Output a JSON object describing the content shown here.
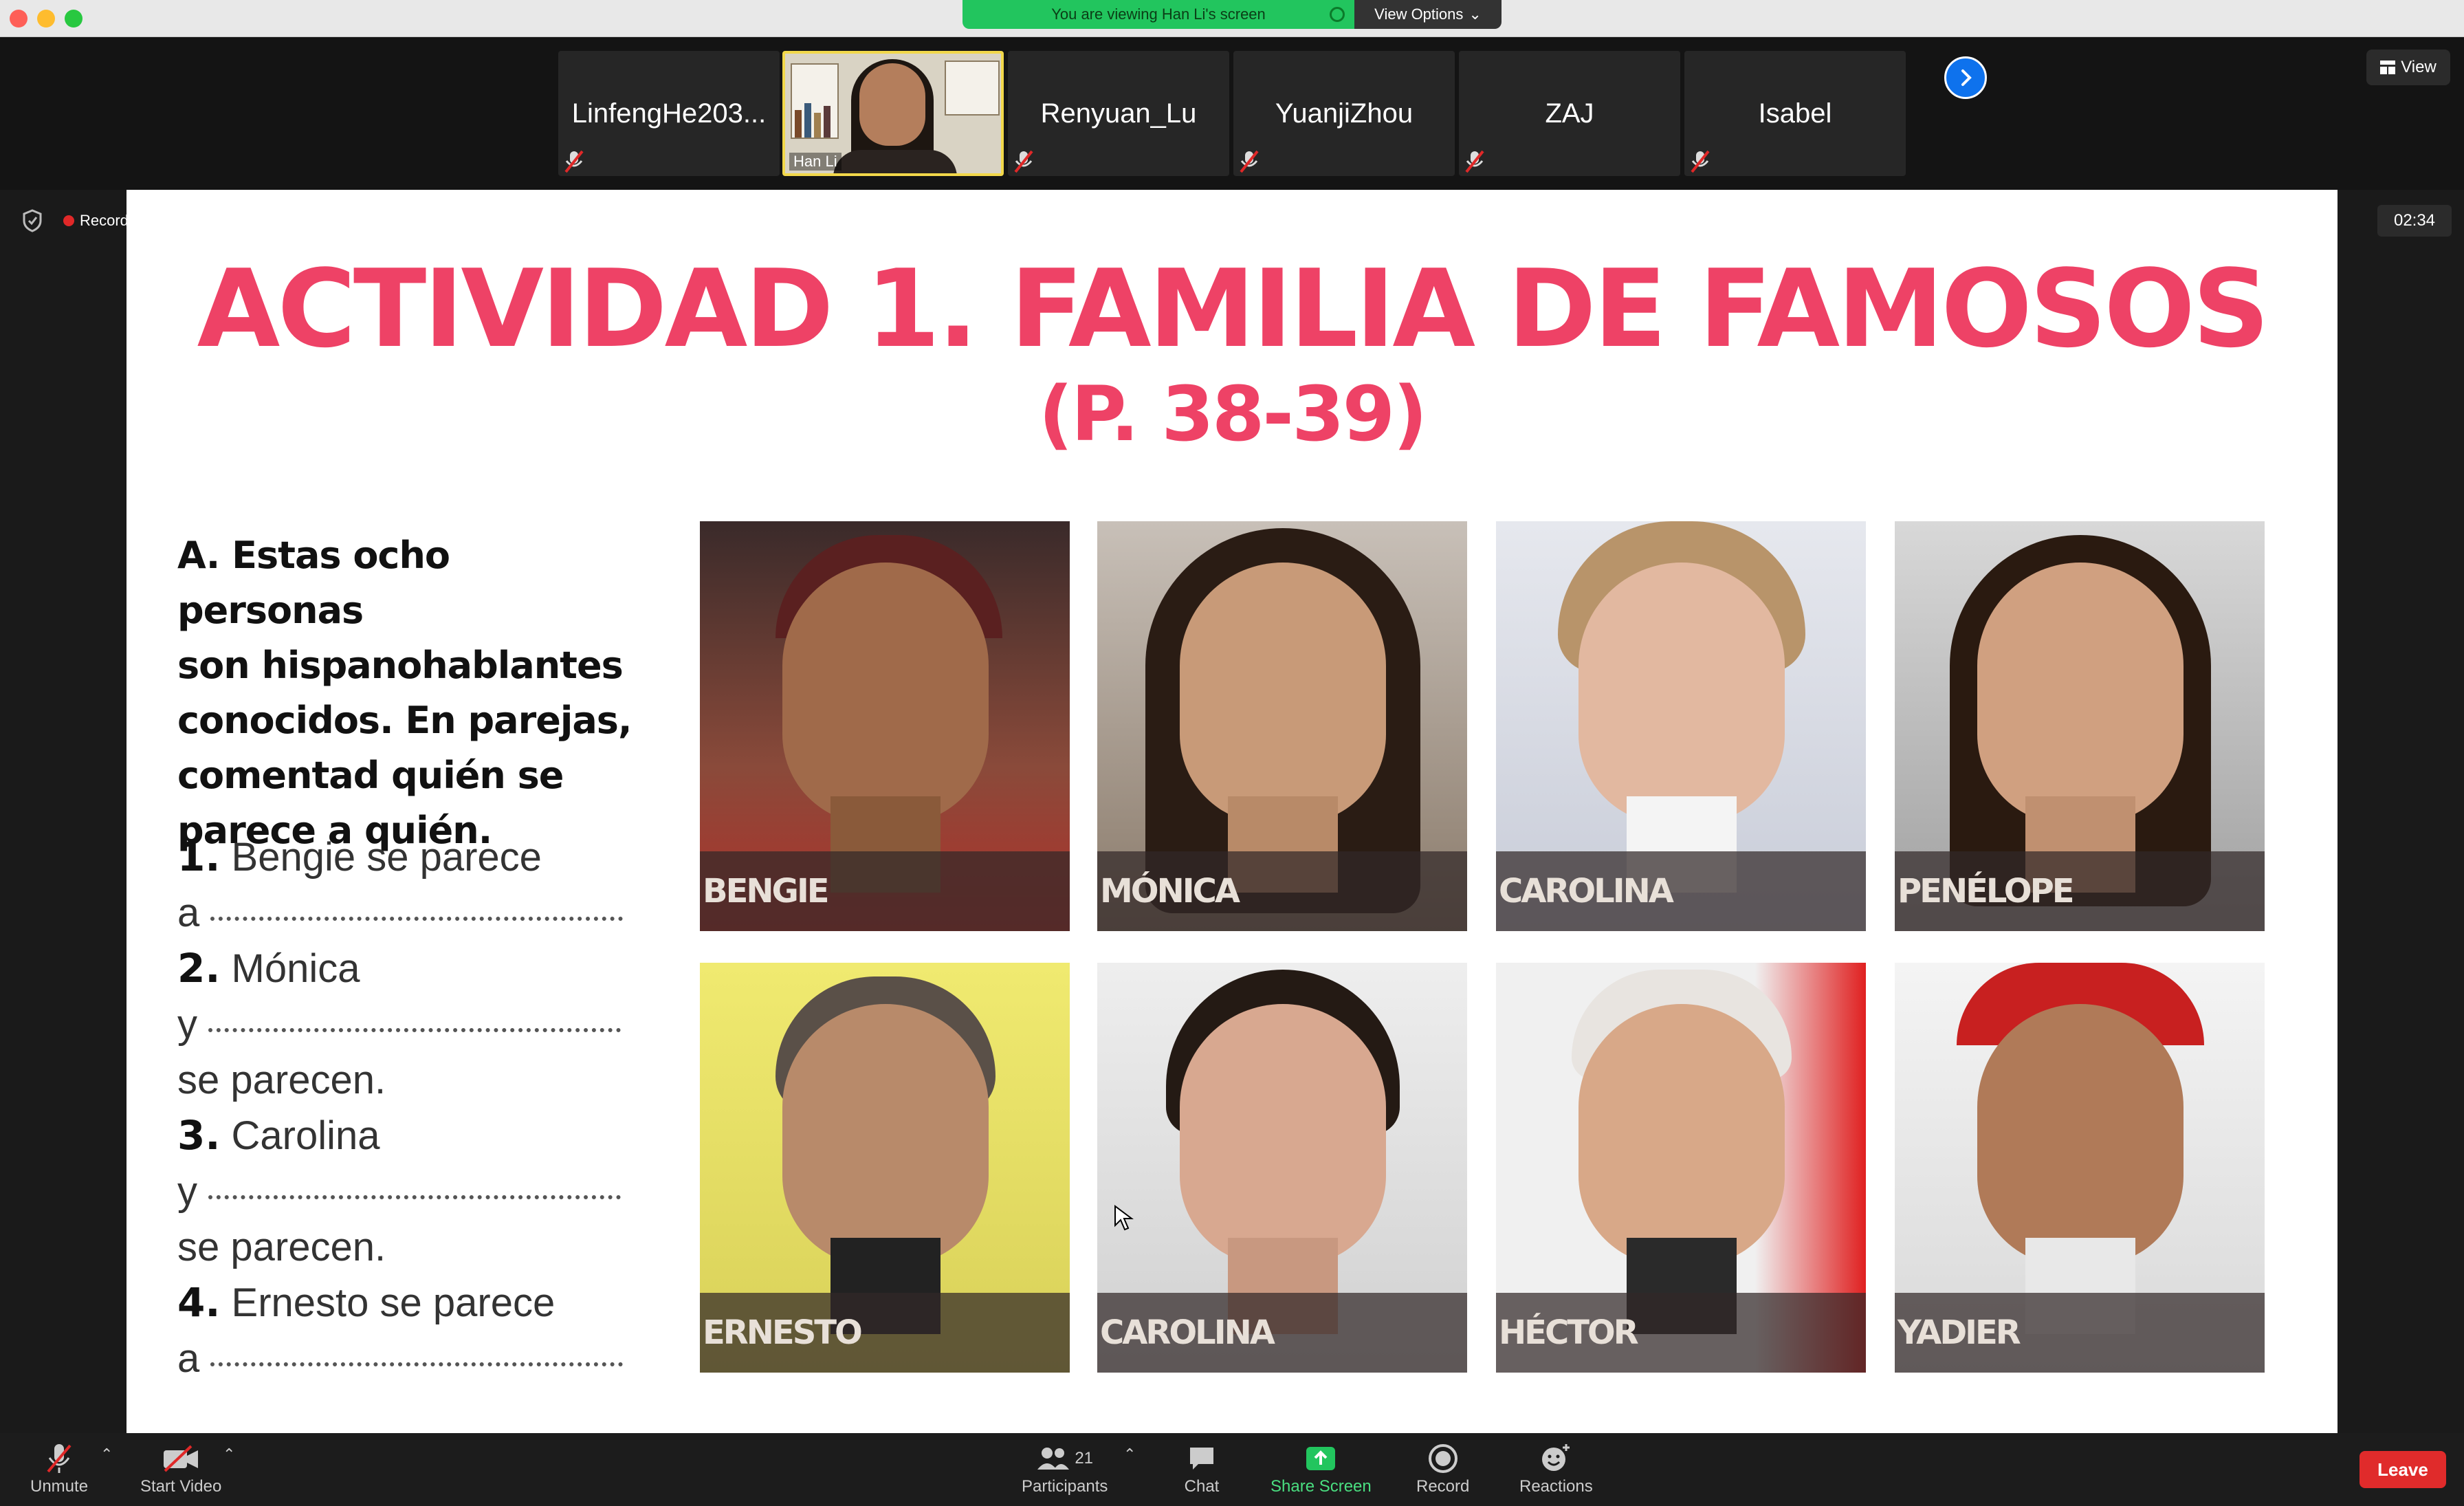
{
  "window": {
    "viewing_banner": "You are viewing Han Li's screen",
    "view_options": "View Options"
  },
  "participants_strip": {
    "tiles": [
      {
        "name": "LinfengHe203...",
        "muted": true
      },
      {
        "name": "Han Li",
        "video": true
      },
      {
        "name": "Renyuan_Lu",
        "muted": true
      },
      {
        "name": "YuanjiZhou",
        "muted": true
      },
      {
        "name": "ZAJ",
        "muted": true
      },
      {
        "name": "Isabel",
        "muted": true
      }
    ],
    "view_label": "View"
  },
  "recording": {
    "label": "Recording",
    "timer": "02:34"
  },
  "slide": {
    "title": "ACTIVIDAD 1. FAMILIA DE FAMOSOS",
    "subtitle": "(P. 38-39)",
    "instructions": [
      "A. Estas ocho personas",
      "son hispanohablantes",
      "conocidos. En parejas,",
      "comentad quién se",
      "parece a quién."
    ],
    "exercise": [
      {
        "num": "1.",
        "line1": "Bengie se parece",
        "line2": "a",
        "line3": ""
      },
      {
        "num": "2.",
        "line1": "Mónica",
        "line2": "y",
        "line3": "se parecen."
      },
      {
        "num": "3.",
        "line1": "Carolina",
        "line2": "y",
        "line3": "se parecen."
      },
      {
        "num": "4.",
        "line1": "Ernesto se parece",
        "line2": "a",
        "line3": ""
      }
    ],
    "photos": [
      {
        "caption": "BENGIE"
      },
      {
        "caption": "MÓNICA"
      },
      {
        "caption": "CAROLINA"
      },
      {
        "caption": "PENÉLOPE"
      },
      {
        "caption": "ERNESTO"
      },
      {
        "caption": "CAROLINA"
      },
      {
        "caption": "HÉCTOR"
      },
      {
        "caption": "YADIER"
      }
    ]
  },
  "toolbar": {
    "unmute": "Unmute",
    "start_video": "Start Video",
    "participants": "Participants",
    "participants_count": "21",
    "chat": "Chat",
    "share_screen": "Share Screen",
    "record": "Record",
    "reactions": "Reactions",
    "leave": "Leave"
  },
  "colors": {
    "accent_pink": "#ee4266",
    "share_green": "#22c55e",
    "leave_red": "#e02b2b",
    "zoom_blue": "#0e72ed"
  }
}
